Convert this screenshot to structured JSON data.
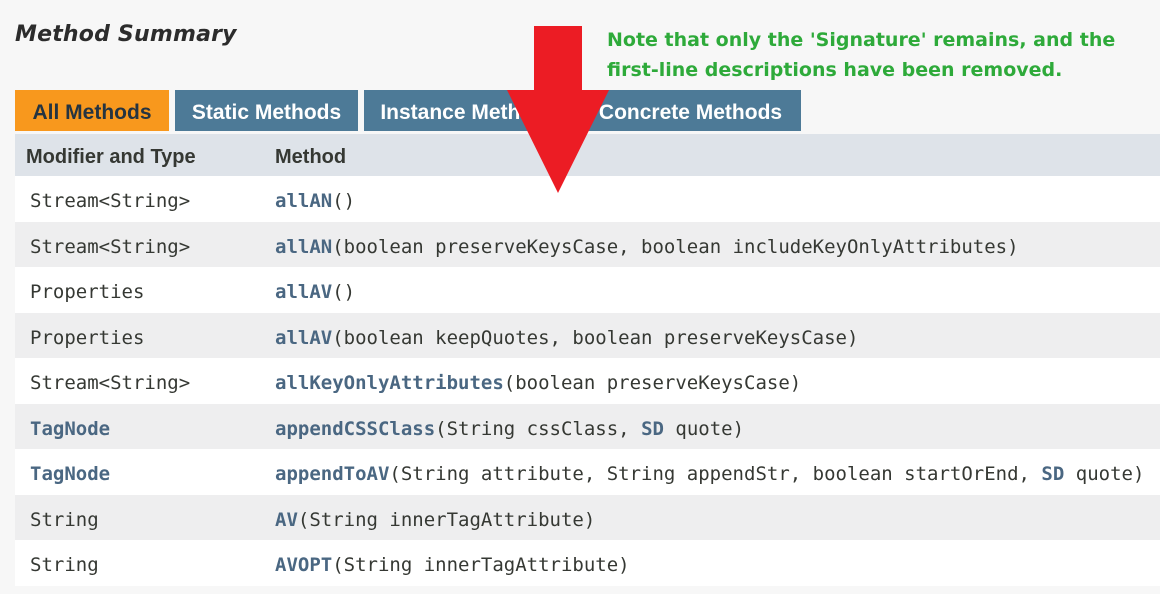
{
  "page": {
    "title": "Method Summary",
    "note_line1": "Note that only the 'Signature' remains, and the",
    "note_line2": "first-line descriptions have been removed."
  },
  "tabs": [
    {
      "label": "All Methods",
      "active": true
    },
    {
      "label": "Static Methods",
      "active": false
    },
    {
      "label": "Instance Methods",
      "active": false
    },
    {
      "label": "Concrete Methods",
      "active": false
    }
  ],
  "table": {
    "headers": [
      "Modifier and Type",
      "Method"
    ],
    "rows": [
      {
        "type": "Stream<String>",
        "type_link": false,
        "method": "allAN",
        "params": [
          {
            "t": "()"
          }
        ]
      },
      {
        "type": "Stream<String>",
        "type_link": false,
        "method": "allAN",
        "params": [
          {
            "t": "(boolean preserveKeysCase, boolean includeKeyOnlyAttributes)"
          }
        ]
      },
      {
        "type": "Properties",
        "type_link": false,
        "method": "allAV",
        "params": [
          {
            "t": "()"
          }
        ]
      },
      {
        "type": "Properties",
        "type_link": false,
        "method": "allAV",
        "params": [
          {
            "t": "(boolean keepQuotes, boolean preserveKeysCase)"
          }
        ]
      },
      {
        "type": "Stream<String>",
        "type_link": false,
        "method": "allKeyOnlyAttributes",
        "params": [
          {
            "t": "(boolean preserveKeysCase)"
          }
        ]
      },
      {
        "type": "TagNode",
        "type_link": true,
        "method": "appendCSSClass",
        "params": [
          {
            "t": "(String cssClass, "
          },
          {
            "t": "SD",
            "link": true
          },
          {
            "t": " quote)"
          }
        ]
      },
      {
        "type": "TagNode",
        "type_link": true,
        "method": "appendToAV",
        "params": [
          {
            "t": "(String attribute, String appendStr, boolean startOrEnd, "
          },
          {
            "t": "SD",
            "link": true
          },
          {
            "t": " quote)"
          }
        ]
      },
      {
        "type": "String",
        "type_link": false,
        "method": "AV",
        "params": [
          {
            "t": "(String innerTagAttribute)"
          }
        ]
      },
      {
        "type": "String",
        "type_link": false,
        "method": "AVOPT",
        "params": [
          {
            "t": "(String innerTagAttribute)"
          }
        ]
      }
    ]
  },
  "colors": {
    "tab_active": "#f8981d",
    "tab_inactive": "#4d7a97",
    "note_green": "#2eaa3a",
    "arrow_red": "#ec1c24",
    "link": "#4a6782"
  }
}
